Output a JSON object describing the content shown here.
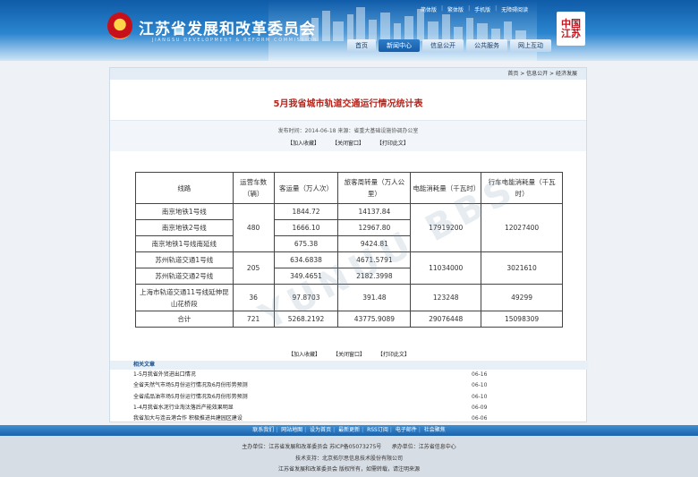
{
  "header": {
    "site_title": "江苏省发展和改革委员会",
    "site_title_en": "JIANGSU DEVELOPMENT & REFORM COMMISSION",
    "top_links": [
      "简体版",
      "繁体版",
      "手机版",
      "无障碍阅读"
    ],
    "nav": [
      "首页",
      "新闻中心",
      "信息公开",
      "公共服务",
      "网上互动"
    ],
    "active_nav": "新闻中心",
    "badge_text": "中国江苏"
  },
  "breadcrumb": "首页 > 信息公开 > 经济发展",
  "article": {
    "title": "5月我省城市轨道交通运行情况统计表",
    "meta": "发布时间：2014-06-18   来源：省重大基础设施协调办公室",
    "actions": [
      "【加入收藏】",
      "【关闭窗口】",
      "【打印此文】"
    ]
  },
  "table": {
    "headers": [
      "线路",
      "运营车数（辆）",
      "客运量（万人次）",
      "旅客周转量（万人公里）",
      "电能消耗量（千瓦时）",
      "行车电能消耗量（千瓦时）"
    ],
    "rows": [
      {
        "line": "南京地铁1号线",
        "passengers": "1844.72",
        "turnover": "14137.84"
      },
      {
        "line": "南京地铁2号线",
        "passengers": "1666.10",
        "turnover": "12967.80"
      },
      {
        "line": "南京地铁1号线南延线",
        "passengers": "675.38",
        "turnover": "9424.81"
      },
      {
        "line": "苏州轨道交通1号线",
        "passengers": "634.6838",
        "turnover": "4671.5791"
      },
      {
        "line": "苏州轨道交通2号线",
        "passengers": "349.4651",
        "turnover": "2182.3998"
      },
      {
        "line": "上海市轨道交通11号线延伸昆山花桥段",
        "passengers": "97.8703",
        "turnover": "391.48"
      }
    ],
    "groups": {
      "nanjing": {
        "cars": "480",
        "energy": "17919200",
        "drive_energy": "12027400"
      },
      "suzhou": {
        "cars": "205",
        "energy": "11034000",
        "drive_energy": "3021610"
      },
      "shanghai": {
        "cars": "36",
        "energy": "123248",
        "drive_energy": "49299"
      }
    },
    "total": {
      "label": "合计",
      "cars": "721",
      "passengers": "5268.2192",
      "turnover": "43775.9089",
      "energy": "29076448",
      "drive_energy": "15098309"
    }
  },
  "related": {
    "heading": "相关文章",
    "items": [
      {
        "title": "1-5月我省外贸进出口情况",
        "date": "06-16"
      },
      {
        "title": "全省天然气市场5月份运行情况及6月份形势预测",
        "date": "06-10"
      },
      {
        "title": "全省成品油市场5月份运行情况及6月份形势预测",
        "date": "06-10"
      },
      {
        "title": "1-4月我省水泥行业淘汰落后产能效果明显",
        "date": "06-09"
      },
      {
        "title": "我省加大与连云港合作 积极推进共建园区建设",
        "date": "06-06"
      }
    ]
  },
  "footer": {
    "links": [
      "联系我们",
      "网站地图",
      "设为首页",
      "最新更新",
      "RSS订阅",
      "电子邮件",
      "社会聚焦"
    ],
    "sponsor": "主办单位：江苏省发展和改革委员会  苏ICP备05073275号",
    "operator": "承办单位：江苏省信息中心",
    "tech": "技术支持：北京拓尔思信息技术股份有限公司",
    "copyright": "江苏省发展和改革委员会 版权所有，如需转载，请注明来源"
  },
  "colors": {
    "header_blue": "#1c6cb8",
    "title_red": "#b3261e",
    "footer_blue": "#2f7cc8"
  }
}
